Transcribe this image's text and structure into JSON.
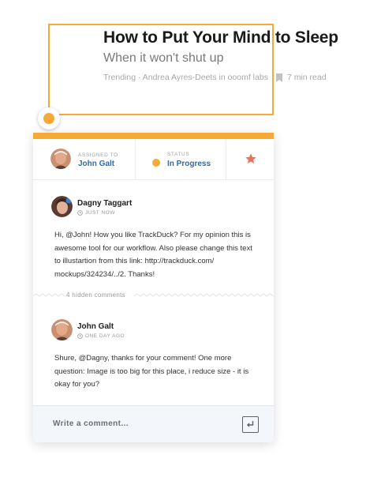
{
  "article": {
    "title": "How to Put Your Mind to Sleep",
    "subtitle": "When it won't shut up",
    "meta": "Trending · Andrea Ayres-Deets in ooomf labs",
    "read_time": "7 min read"
  },
  "colors": {
    "accent": "#f6a935",
    "link": "#2a6db0",
    "star": "#e8735a",
    "compose_bg": "#f3f6fb"
  },
  "task": {
    "assigned_label": "Assigned to",
    "assignee": "John Galt",
    "status_label": "Status",
    "status": "In Progress",
    "star_icon": "star-icon"
  },
  "comments": [
    {
      "author": "Dagny Taggart",
      "time": "JUST NOW",
      "text": "Hi, @John! How you like TrackDuck? For my opinion this is awesome tool for our workflow. Also please change this text to illustartion from this link: http://trackduck.com/ mockups/324234/../2. Thanks!"
    },
    {
      "author": "John Galt",
      "time": "ONE DAY AGO",
      "text": "Shure, @Dagny, thanks for your comment! One more question: Image is too big for this place, i reduce size - it is okay for you?"
    }
  ],
  "hidden_comments": "4 hidden comments",
  "compose": {
    "placeholder": "Write a comment..."
  }
}
